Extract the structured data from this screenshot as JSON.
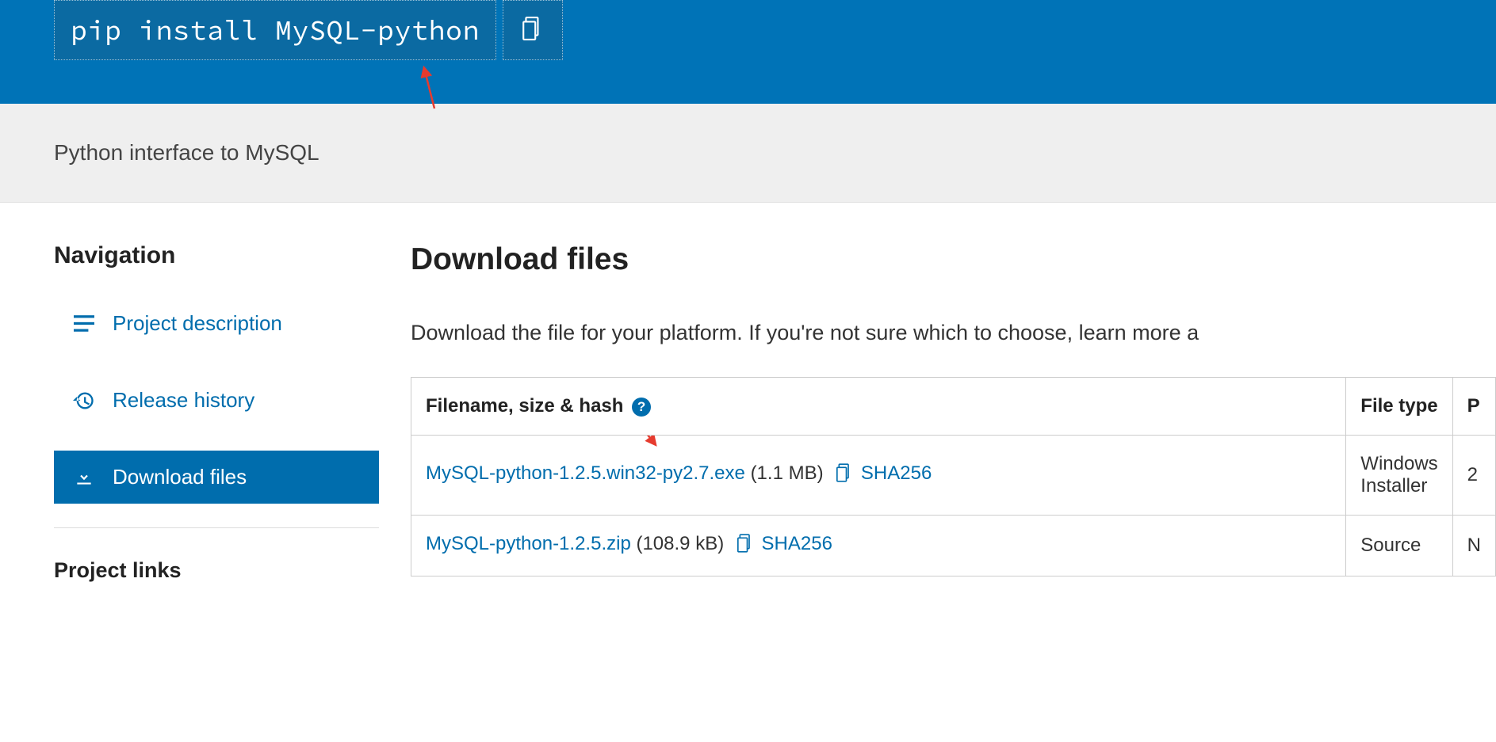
{
  "header": {
    "pip_command": "pip install MySQL-python"
  },
  "description": "Python interface to MySQL",
  "sidebar": {
    "nav_heading": "Navigation",
    "items": [
      {
        "label": "Project description"
      },
      {
        "label": "Release history"
      },
      {
        "label": "Download files"
      }
    ],
    "links_heading": "Project links"
  },
  "content": {
    "heading": "Download files",
    "subtext": "Download the file for your platform. If you're not sure which to choose, learn more a",
    "table": {
      "col_filename": "Filename, size & hash",
      "col_filetype": "File type",
      "col_p": "P",
      "rows": [
        {
          "filename": "MySQL-python-1.2.5.win32-py2.7.exe",
          "size": "(1.1 MB)",
          "hash_label": "SHA256",
          "filetype": "Windows Installer",
          "p": "2"
        },
        {
          "filename": "MySQL-python-1.2.5.zip",
          "size": "(108.9 kB)",
          "hash_label": "SHA256",
          "filetype": "Source",
          "p": "N"
        }
      ]
    }
  }
}
